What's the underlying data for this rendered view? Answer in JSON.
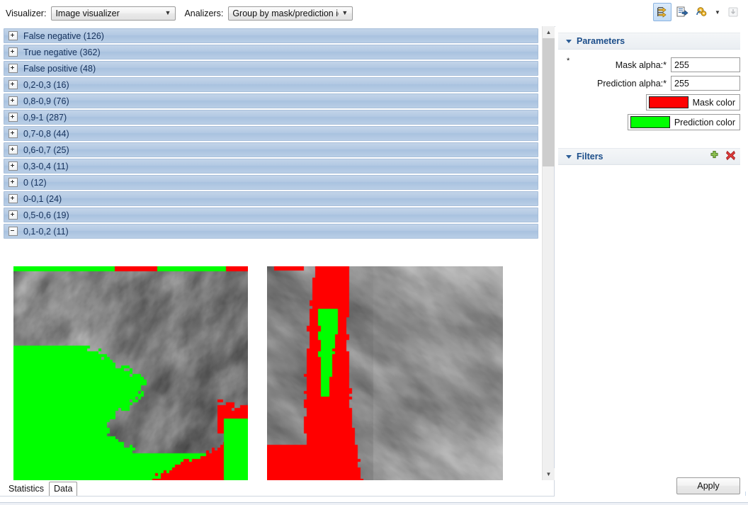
{
  "toolbar": {
    "visualizer_label": "Visualizer:",
    "visualizer_value": "Image visualizer",
    "analizers_label": "Analizers:",
    "analizers_value": "Group by mask/prediction io",
    "icons": [
      {
        "name": "insert-rows-icon",
        "state": "active"
      },
      {
        "name": "export-report-icon",
        "state": "normal"
      },
      {
        "name": "run-analysis-icon",
        "state": "normal"
      },
      {
        "name": "dropdown-arrow-icon",
        "state": "normal"
      },
      {
        "name": "save-to-disk-icon",
        "state": "disabled"
      }
    ]
  },
  "tree": {
    "rows": [
      {
        "label": "False negative (126)",
        "expanded": false
      },
      {
        "label": "True negative (362)",
        "expanded": false
      },
      {
        "label": "False positive (48)",
        "expanded": false
      },
      {
        "label": "0,2-0,3 (16)",
        "expanded": false
      },
      {
        "label": "0,8-0,9 (76)",
        "expanded": false
      },
      {
        "label": "0,9-1 (287)",
        "expanded": false
      },
      {
        "label": "0,7-0,8 (44)",
        "expanded": false
      },
      {
        "label": "0,6-0,7 (25)",
        "expanded": false
      },
      {
        "label": "0,3-0,4 (11)",
        "expanded": false
      },
      {
        "label": "0 (12)",
        "expanded": false
      },
      {
        "label": "0-0,1 (24)",
        "expanded": false
      },
      {
        "label": "0,5-0,6 (19)",
        "expanded": false
      },
      {
        "label": "0,1-0,2 (11)",
        "expanded": true
      }
    ],
    "thumbnails": [
      {
        "name": "sample-image-1"
      },
      {
        "name": "sample-image-2"
      }
    ],
    "scroll": {
      "up_arrow": "▲",
      "down_arrow": "▼"
    }
  },
  "tabs": {
    "items": [
      {
        "label": "Statistics",
        "selected": false
      },
      {
        "label": "Data",
        "selected": true
      }
    ]
  },
  "parameters": {
    "title": "Parameters",
    "required_mark": "*",
    "mask_alpha_label": "Mask alpha:*",
    "mask_alpha_value": "255",
    "prediction_alpha_label": "Prediction alpha:*",
    "prediction_alpha_value": "255",
    "mask_color_label": "Mask color",
    "mask_color": "#ff0000",
    "prediction_color_label": "Prediction color",
    "prediction_color": "#00ff00"
  },
  "filters": {
    "title": "Filters",
    "add_icon": "plus-icon",
    "remove_icon": "delete-icon"
  },
  "actions": {
    "apply_label": "Apply"
  },
  "colors": {
    "row_gradient_top": "#c2d4e9",
    "row_gradient_bottom": "#b9cee6",
    "row_text": "#16325c",
    "section_title": "#1c4e8a",
    "mask": "#ff0000",
    "prediction": "#00ff00"
  }
}
